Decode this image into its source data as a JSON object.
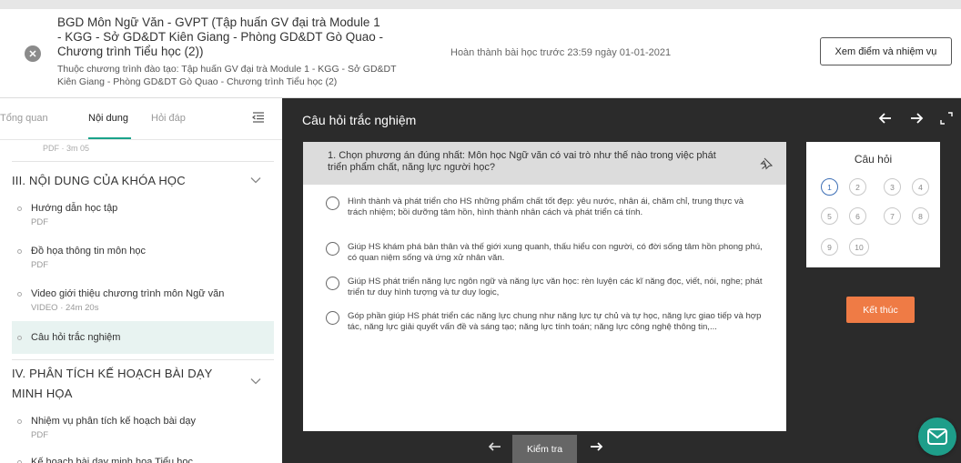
{
  "header": {
    "course_title": "BGD Môn Ngữ Văn - GVPT (Tập huấn GV đại trà Module 1 - KGG - Sở GD&DT Kiên Giang - Phòng GD&DT Gò Quao - Chương trình Tiểu học (2))",
    "program": "Thuộc chương trình đào tạo: Tập huấn GV đại trà Module 1 - KGG - Sở GD&DT Kiên Giang - Phòng GD&DT Gò Quao - Chương trình Tiểu học (2)",
    "deadline": "Hoàn thành bài học trước 23:59 ngày 01-01-2021",
    "scores_button": "Xem điểm và nhiệm vụ",
    "close_icon": "close-icon"
  },
  "sidebar": {
    "tabs": [
      "Tổng quan",
      "Nội dung",
      "Hỏi đáp"
    ],
    "active_tab": "Nội dung",
    "cut_off_text": "PDF · 3m 05",
    "sections": [
      {
        "title": "III. NỘI DUNG CỦA KHÓA HỌC",
        "items": [
          {
            "title": "Hướng dẫn học tập",
            "sub": "PDF"
          },
          {
            "title": "Đồ họa thông tin môn học",
            "sub": "PDF"
          },
          {
            "title": "Video giới thiệu chương trình môn Ngữ văn",
            "sub": "VIDEO · 24m 20s"
          },
          {
            "title": "Câu hỏi trắc nghiệm",
            "sub": ""
          }
        ]
      },
      {
        "title": "IV. PHÂN TÍCH KẾ HOẠCH BÀI DẠY MINH HỌA",
        "items": [
          {
            "title": "Nhiệm vụ phân tích kế hoạch bài dạy",
            "sub": "PDF"
          },
          {
            "title": "Kế hoạch bài dạy minh họa Tiểu học",
            "sub": ""
          }
        ]
      }
    ]
  },
  "main": {
    "title": "Câu hỏi trắc nghiệm",
    "question": "1. Chọn phương án đúng nhất: Môn học Ngữ văn có vai trò như thế nào trong việc phát triển phẩm chất, năng lực người học?",
    "options": [
      "Hình thành và phát triển cho HS những phẩm chất tốt đẹp: yêu nước, nhân ái, chăm chỉ, trung thực và trách nhiệm; bồi dưỡng tâm hồn, hình thành nhân cách và phát triển cá tính.",
      "Giúp HS khám phá bản thân và thế giới xung quanh, thấu hiểu con người, có đời sống tâm hồn phong phú, có quan niệm sống và ứng xử nhân văn.",
      "Giúp HS phát triển năng lực ngôn ngữ và năng lực văn học: rèn luyện các kĩ năng đọc, viết, nói, nghe; phát triển tư duy hình tượng và tư duy logic,",
      "Góp phần giúp HS phát triển các năng lực chung như năng lực tự chủ và tự học, năng lực giao tiếp và hợp tác, năng lực giải quyết vấn đề và sáng tạo; năng lực tính toán; năng lực công nghệ thông tin,..."
    ],
    "questions_panel": {
      "title": "Câu hỏi",
      "numbers": [
        "1",
        "2",
        "3",
        "4",
        "5",
        "6",
        "7",
        "8",
        "9",
        "10"
      ],
      "current": "1"
    },
    "finish_button": "Kết thúc",
    "check_button": "Kiểm tra"
  },
  "colors": {
    "accent": "#1aa38a",
    "finish": "#ef7b45",
    "dark_bg": "#2b2b2b",
    "current_question": "#3d6fb6"
  }
}
